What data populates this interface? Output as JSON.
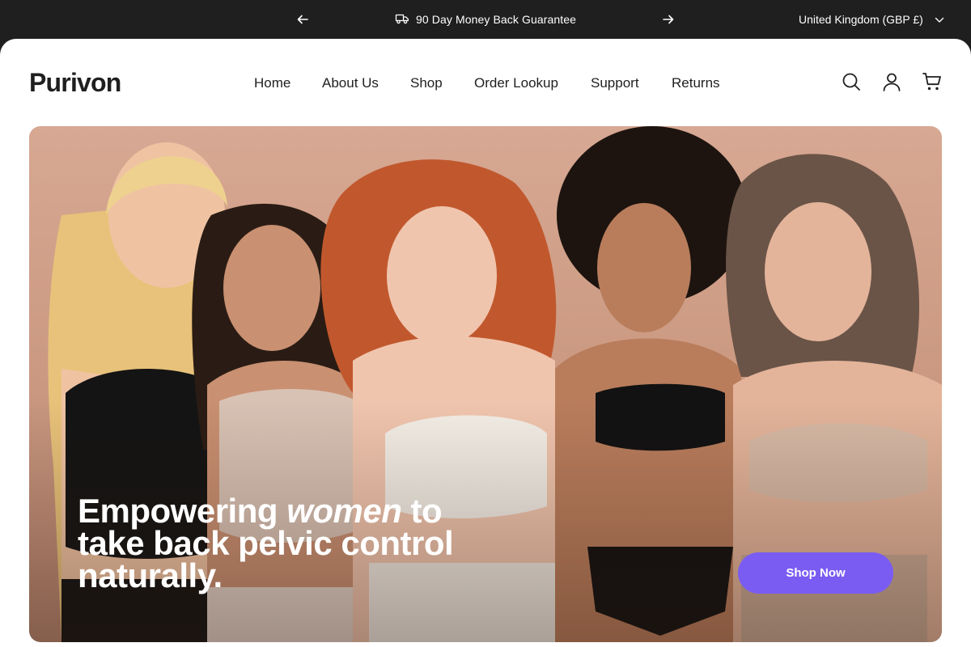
{
  "announcement": {
    "message": "90 Day Money Back Guarantee",
    "locale": "United Kingdom (GBP £)"
  },
  "header": {
    "logo": "Purivon",
    "nav": [
      "Home",
      "About Us",
      "Shop",
      "Order Lookup",
      "Support",
      "Returns"
    ]
  },
  "hero": {
    "headline_pre": "Empowering ",
    "headline_em": "women",
    "headline_post": " to take back pelvic control naturally.",
    "cta": "Shop Now"
  },
  "colors": {
    "accent": "#7a5cf2",
    "topbar": "#1f1f1f"
  }
}
